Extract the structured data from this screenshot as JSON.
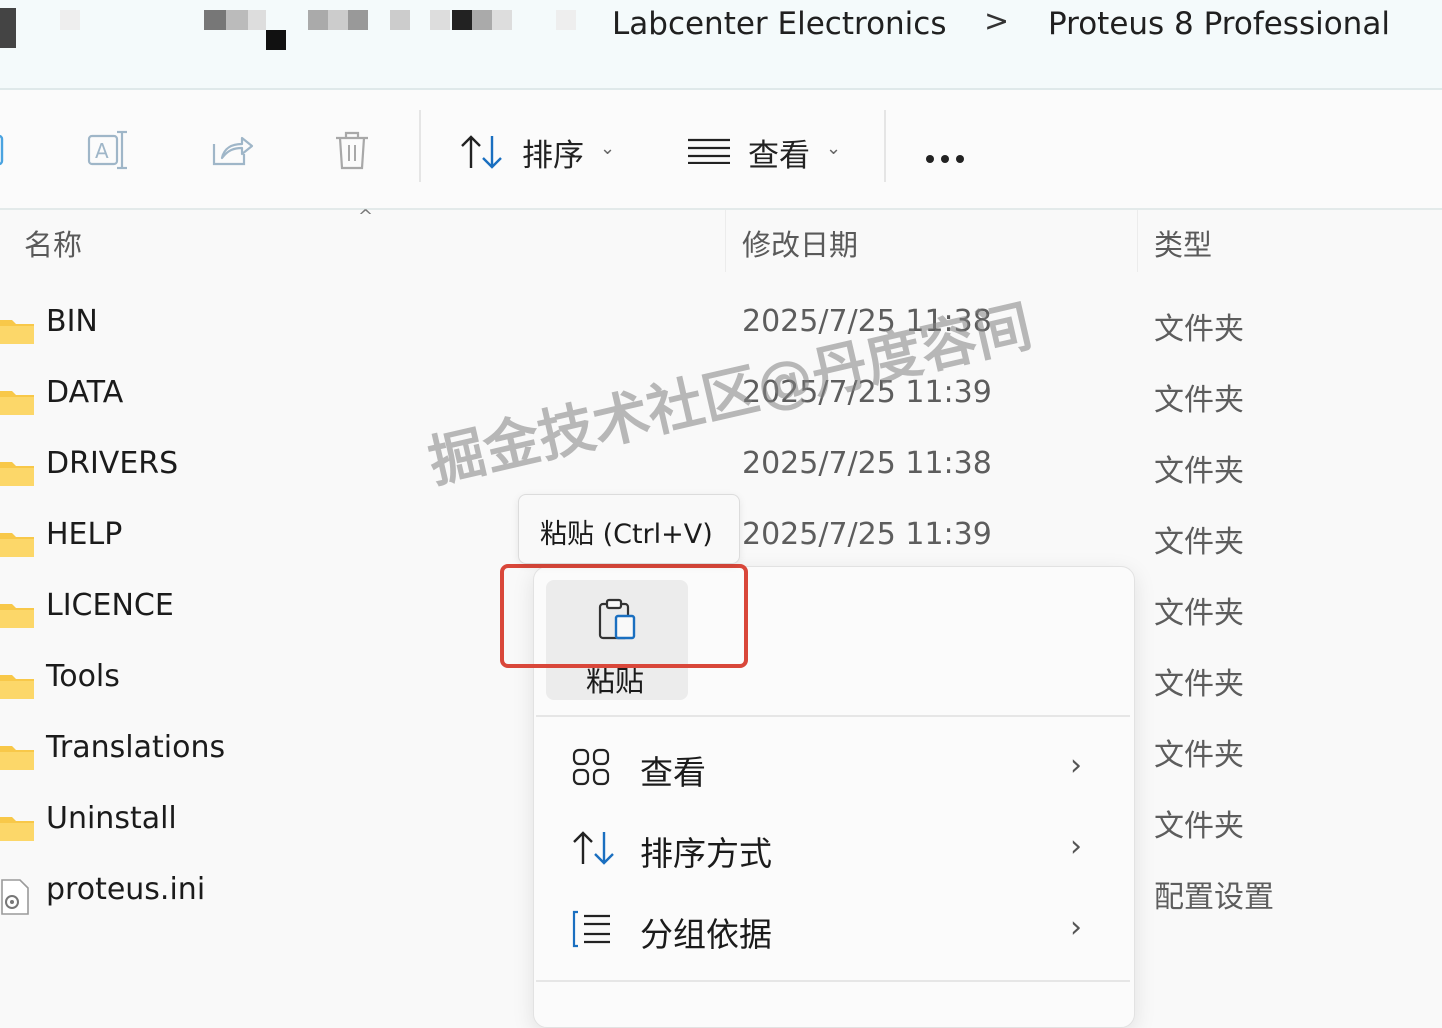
{
  "breadcrumb": {
    "items": [
      "Labcenter Electronics",
      "Proteus 8 Professional"
    ],
    "separator": ">"
  },
  "toolbar": {
    "sort_label": "排序",
    "view_label": "查看",
    "icons": [
      "rename-icon",
      "share-icon",
      "delete-icon",
      "sort-icon",
      "view-icon",
      "more-icon"
    ]
  },
  "columns": {
    "name": "名称",
    "modified": "修改日期",
    "type": "类型"
  },
  "files": [
    {
      "name": "BIN",
      "date": "2025/7/25 11:38",
      "type": "文件夹",
      "icon": "folder-icon"
    },
    {
      "name": "DATA",
      "date": "2025/7/25 11:39",
      "type": "文件夹",
      "icon": "folder-icon"
    },
    {
      "name": "DRIVERS",
      "date": "2025/7/25 11:38",
      "type": "文件夹",
      "icon": "folder-icon"
    },
    {
      "name": "HELP",
      "date": "2025/7/25 11:39",
      "type": "文件夹",
      "icon": "folder-icon"
    },
    {
      "name": "LICENCE",
      "date": "",
      "type": "文件夹",
      "icon": "folder-icon"
    },
    {
      "name": "Tools",
      "date": "",
      "type": "文件夹",
      "icon": "folder-icon"
    },
    {
      "name": "Translations",
      "date": "",
      "type": "文件夹",
      "icon": "folder-icon"
    },
    {
      "name": "Uninstall",
      "date": "",
      "type": "文件夹",
      "icon": "folder-icon"
    },
    {
      "name": "proteus.ini",
      "date": "",
      "type": "配置设置",
      "icon": "ini-file-icon"
    }
  ],
  "context_menu": {
    "tooltip": "粘贴 (Ctrl+V)",
    "paste_label": "粘贴",
    "items": [
      {
        "label": "查看",
        "icon": "grid-view-icon"
      },
      {
        "label": "排序方式",
        "icon": "sort-icon"
      },
      {
        "label": "分组依据",
        "icon": "group-by-icon"
      }
    ]
  },
  "watermark": "掘金技术社区@丹度容间",
  "colors": {
    "folder": "#f8c849",
    "highlight": "#d9473a",
    "address_bg": "#f4fafb"
  }
}
